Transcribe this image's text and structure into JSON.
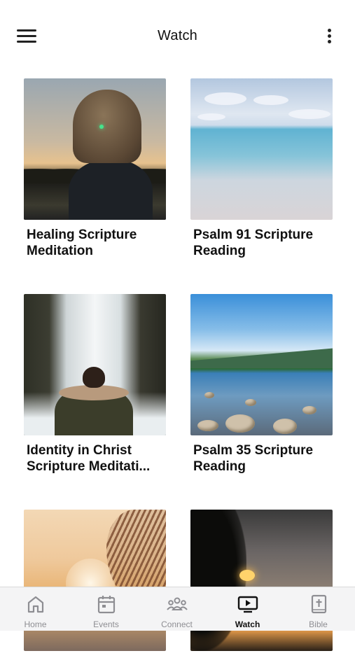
{
  "header": {
    "title": "Watch",
    "menu_icon": "hamburger-menu-icon",
    "more_icon": "vertical-ellipsis-icon"
  },
  "videos": [
    {
      "title": "Healing Scripture Meditation"
    },
    {
      "title": "Psalm 91 Scripture Reading"
    },
    {
      "title": "Identity in Christ Scripture Meditati..."
    },
    {
      "title": "Psalm 35 Scripture Reading"
    },
    {
      "title": ""
    },
    {
      "title": ""
    }
  ],
  "tabs": [
    {
      "label": "Home",
      "icon": "home-icon",
      "active": false
    },
    {
      "label": "Events",
      "icon": "calendar-icon",
      "active": false
    },
    {
      "label": "Connect",
      "icon": "people-group-icon",
      "active": false
    },
    {
      "label": "Watch",
      "icon": "tv-play-icon",
      "active": true
    },
    {
      "label": "Bible",
      "icon": "bible-cross-icon",
      "active": false
    }
  ],
  "colors": {
    "active_tab": "#111111",
    "inactive_tab": "#8e8e93",
    "tabbar_bg": "#f4f4f5"
  }
}
